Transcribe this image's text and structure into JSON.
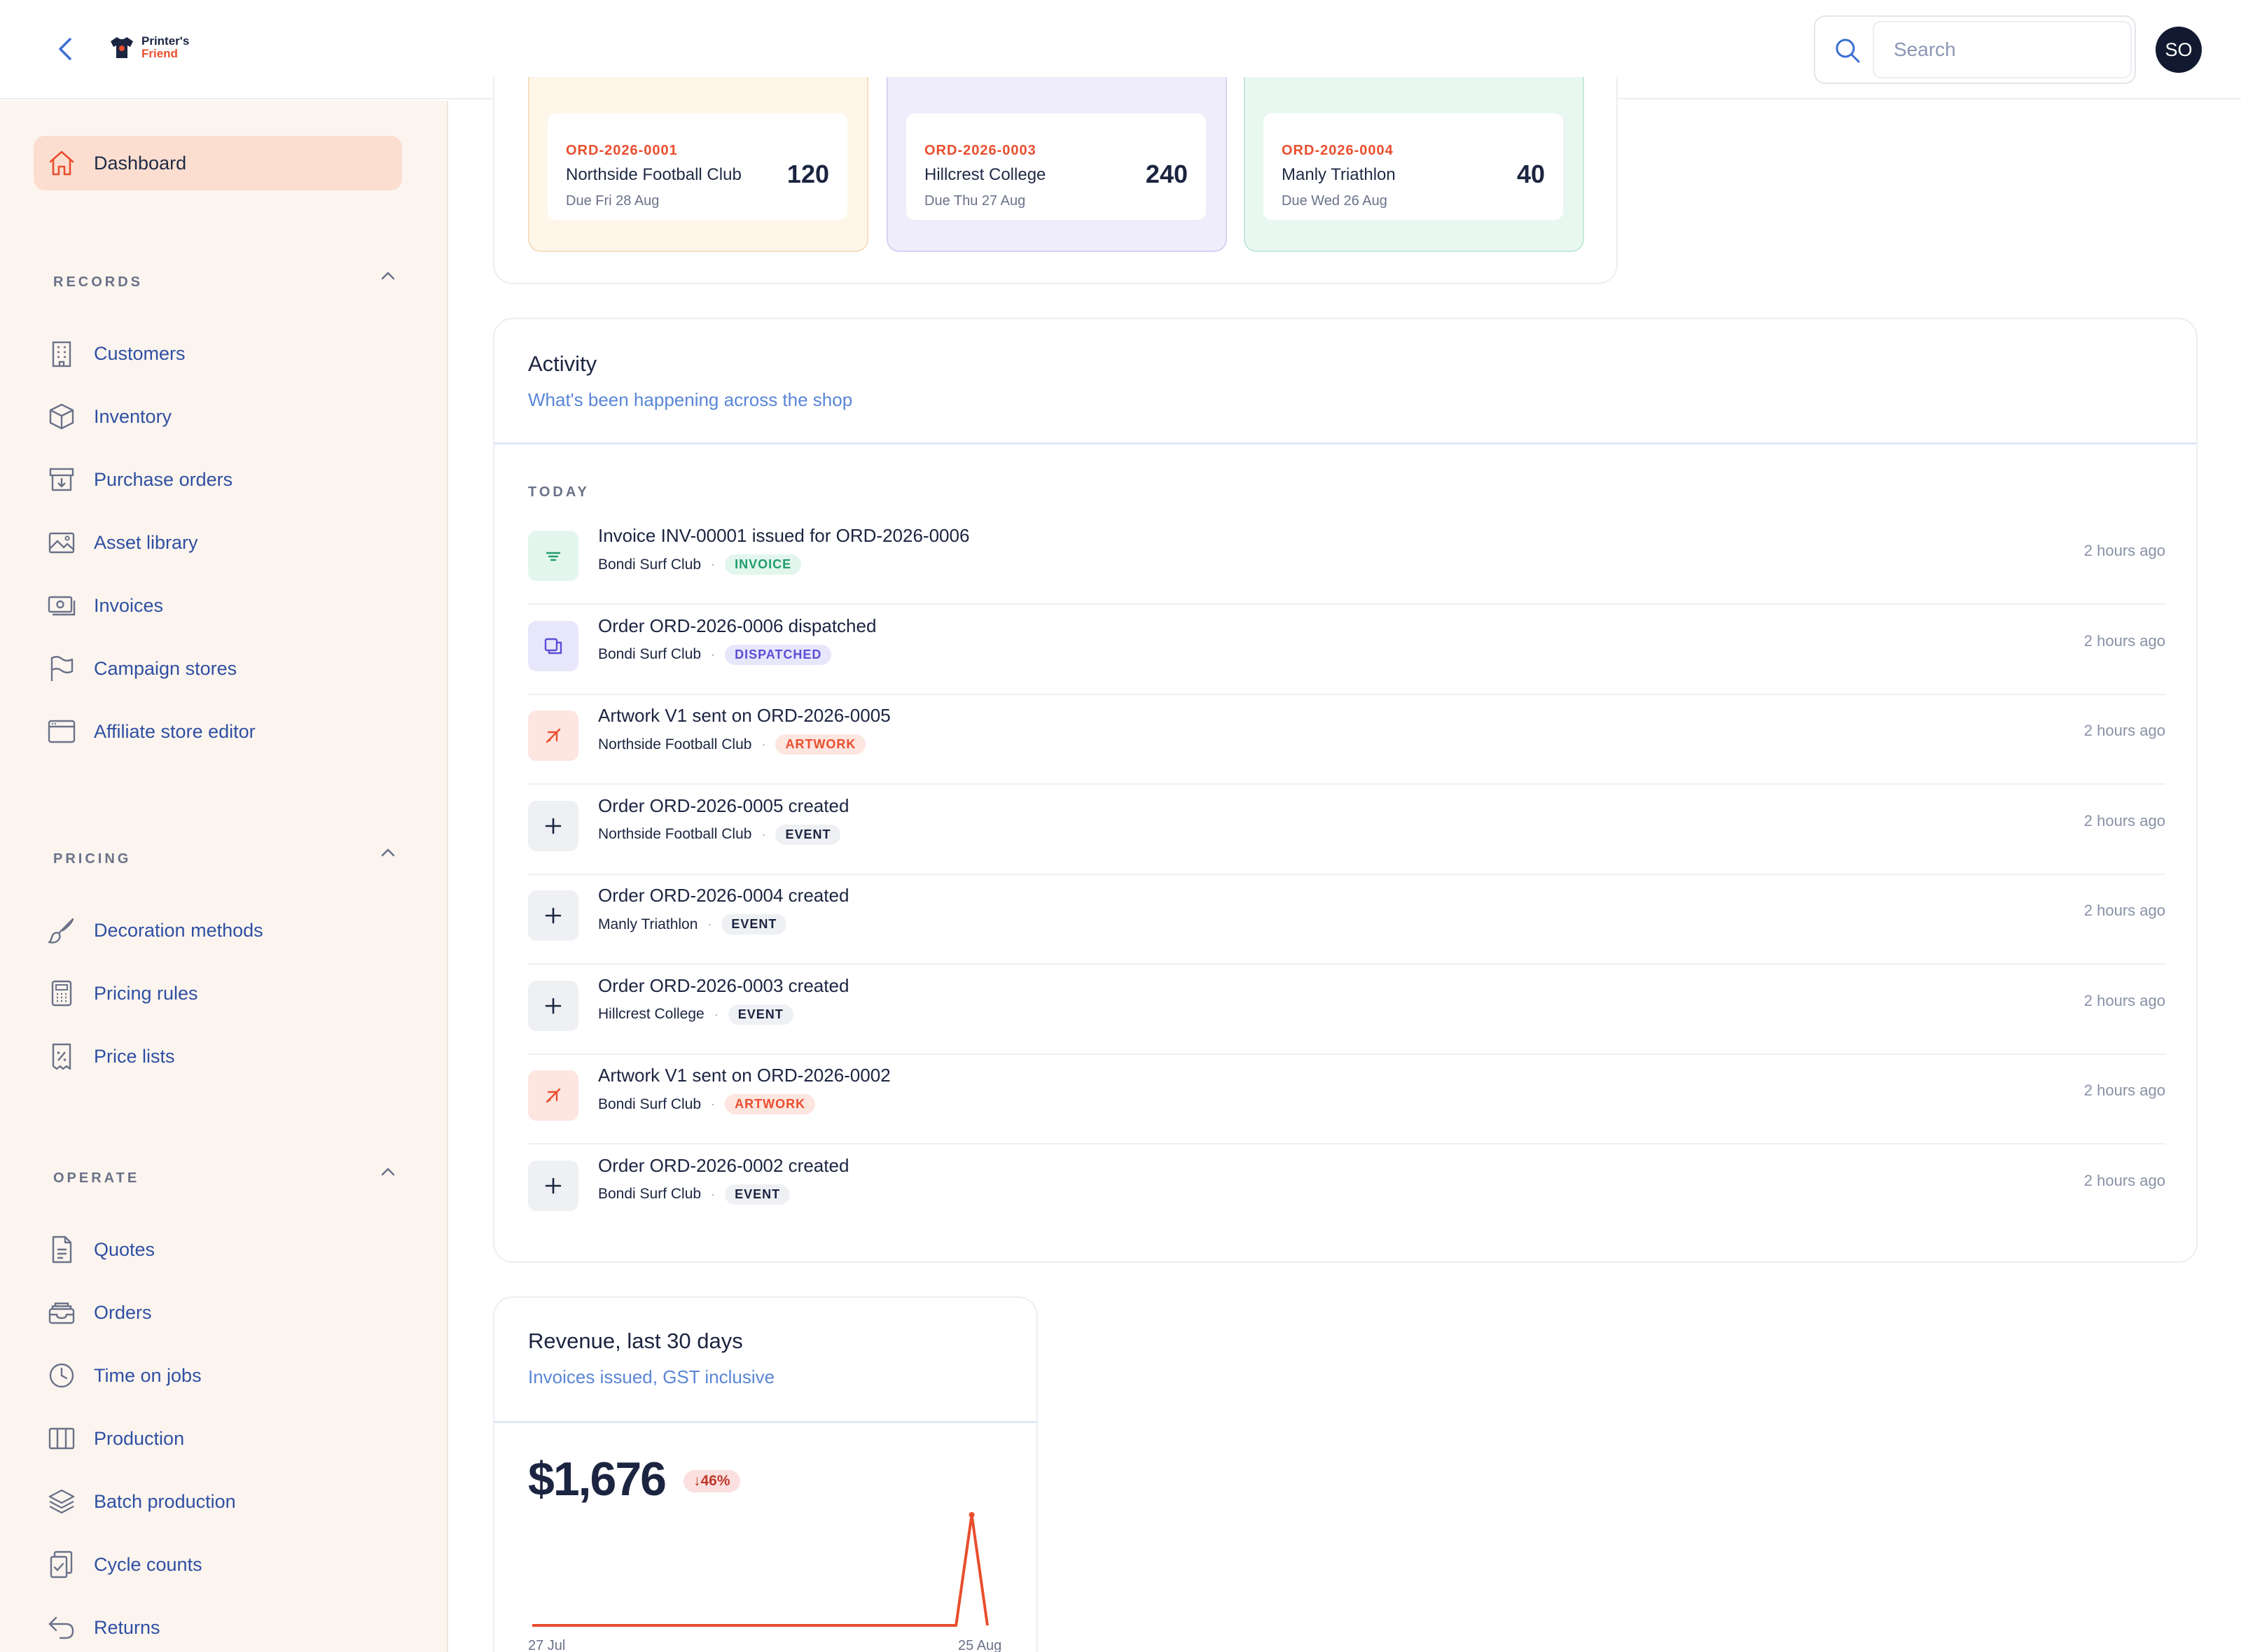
{
  "header": {
    "logo": {
      "line1": "Printer's",
      "line2": "Friend"
    },
    "search_placeholder": "Search",
    "avatar_initials": "SO"
  },
  "sidebar": {
    "dashboard": "Dashboard",
    "sections": [
      {
        "label": "RECORDS",
        "items": [
          "Customers",
          "Inventory",
          "Purchase orders",
          "Asset library",
          "Invoices",
          "Campaign stores",
          "Affiliate store editor"
        ]
      },
      {
        "label": "PRICING",
        "items": [
          "Decoration methods",
          "Pricing rules",
          "Price lists"
        ]
      },
      {
        "label": "OPERATE",
        "items": [
          "Quotes",
          "Orders",
          "Time on jobs",
          "Production",
          "Batch production",
          "Cycle counts",
          "Returns"
        ]
      }
    ]
  },
  "due_orders": [
    {
      "id": "ORD-2026-0001",
      "customer": "Northside Football Club",
      "due": "Due Fri 28 Aug",
      "qty": "120",
      "tint": "#fff6ea",
      "border": "#f6dfc0"
    },
    {
      "id": "ORD-2026-0003",
      "customer": "Hillcrest College",
      "due": "Due Thu 27 Aug",
      "qty": "240",
      "tint": "#efedfb",
      "border": "#d6d1f2"
    },
    {
      "id": "ORD-2026-0004",
      "customer": "Manly Triathlon",
      "due": "Due Wed 26 Aug",
      "qty": "40",
      "tint": "#e9f7f1",
      "border": "#c4e9d8"
    }
  ],
  "activity": {
    "title": "Activity",
    "subtitle": "What's been happening across the shop",
    "group_label": "TODAY",
    "rows": [
      {
        "title": "Invoice INV-00001 issued for ORD-2026-0006",
        "customer": "Bondi Surf Club",
        "badge": "INVOICE",
        "kind": "invoice",
        "time": "2 hours ago"
      },
      {
        "title": "Order ORD-2026-0006 dispatched",
        "customer": "Bondi Surf Club",
        "badge": "DISPATCHED",
        "kind": "dispatched",
        "time": "2 hours ago"
      },
      {
        "title": "Artwork V1 sent on ORD-2026-0005",
        "customer": "Northside Football Club",
        "badge": "ARTWORK",
        "kind": "artwork",
        "time": "2 hours ago"
      },
      {
        "title": "Order ORD-2026-0005 created",
        "customer": "Northside Football Club",
        "badge": "EVENT",
        "kind": "event",
        "time": "2 hours ago"
      },
      {
        "title": "Order ORD-2026-0004 created",
        "customer": "Manly Triathlon",
        "badge": "EVENT",
        "kind": "event",
        "time": "2 hours ago"
      },
      {
        "title": "Order ORD-2026-0003 created",
        "customer": "Hillcrest College",
        "badge": "EVENT",
        "kind": "event",
        "time": "2 hours ago"
      },
      {
        "title": "Artwork V1 sent on ORD-2026-0002",
        "customer": "Bondi Surf Club",
        "badge": "ARTWORK",
        "kind": "artwork",
        "time": "2 hours ago"
      },
      {
        "title": "Order ORD-2026-0002 created",
        "customer": "Bondi Surf Club",
        "badge": "EVENT",
        "kind": "event",
        "time": "2 hours ago"
      }
    ]
  },
  "revenue": {
    "title": "Revenue, last 30 days",
    "subtitle": "Invoices issued, GST inclusive",
    "amount": "$1,676",
    "change": "↓46%",
    "x_start": "27 Jul",
    "x_end": "25 Aug",
    "series_color": "#e94e2e",
    "daily_values": [
      0,
      0,
      0,
      0,
      0,
      0,
      0,
      0,
      0,
      0,
      0,
      0,
      0,
      0,
      0,
      0,
      0,
      0,
      0,
      0,
      0,
      0,
      0,
      0,
      0,
      0,
      0,
      0,
      1676,
      0
    ]
  },
  "colors": {
    "accent": "#e94e2e",
    "link": "#2f4fa3",
    "invoice": {
      "bg": "#e3f6ee",
      "fg": "#1f9d6b"
    },
    "dispatched": {
      "bg": "#e8e6fb",
      "fg": "#5b4fd6"
    },
    "artwork": {
      "bg": "#fde5e0",
      "fg": "#e94e2e"
    },
    "event": {
      "bg": "#eef0f3",
      "fg": "#1b2440"
    }
  }
}
